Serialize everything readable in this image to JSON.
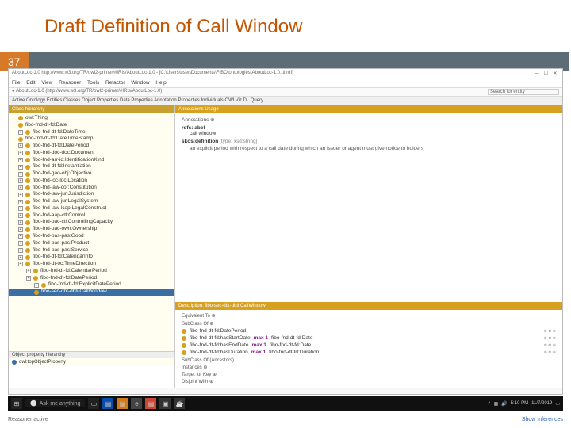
{
  "slide": {
    "title": "Draft Definition of Call Window",
    "number": "37"
  },
  "app_title": "AboutLoc-1.0  http://www.w3.org/TR/owl2-primer/#IRIs/AboutLoc-1.0  - [C:\\Users\\user\\Documents\\FIBO\\ontologies\\AboutLoc-1.0.ttl.rdf]",
  "window_controls": {
    "min": "—",
    "max": "☐",
    "close": "✕"
  },
  "menu": [
    "File",
    "Edit",
    "View",
    "Reasoner",
    "Tools",
    "Refactor",
    "Window",
    "Help"
  ],
  "address": "http://www.w3.org/TR/owl2-primer/#IRIs/AboutLoc-1.0",
  "search_placeholder": "Search for entity",
  "toolbar_text": "Active Ontology  Entities  Classes  Object Properties  Data Properties  Annotation Properties  Individuals  OWLViz  DL Query",
  "left_panel_title": "Class hierarchy",
  "tree": [
    {
      "label": "owl:Thing",
      "nest": 0
    },
    {
      "label": "fibo-fnd-dt-fd:Date",
      "nest": 0
    },
    {
      "label": "fibo-fnd-dt-fd:DateTime",
      "nest": 0,
      "exp": true
    },
    {
      "label": "fibo-fnd-dt-fd:DateTimeStamp",
      "nest": 0
    },
    {
      "label": "fibo-fnd-dt-fd:DatePeriod",
      "nest": 0,
      "exp": true
    },
    {
      "label": "fibo-fnd-doc-doc:Document",
      "nest": 0,
      "exp": true
    },
    {
      "label": "fibo-fnd-arr-id:IdentificationKind",
      "nest": 0,
      "exp": true
    },
    {
      "label": "fibo-fnd-dt-fd:Instantiation",
      "nest": 0,
      "exp": true
    },
    {
      "label": "fibo-fnd-gao-obj:Objective",
      "nest": 0,
      "exp": true
    },
    {
      "label": "fibo-fnd-loc-loc:Location",
      "nest": 0,
      "exp": true
    },
    {
      "label": "fibo-fnd-law-cor:Constitution",
      "nest": 0,
      "exp": true
    },
    {
      "label": "fibo-fnd-law-jur:Jurisdiction",
      "nest": 0,
      "exp": true
    },
    {
      "label": "fibo-fnd-law-jur:LegalSystem",
      "nest": 0,
      "exp": true
    },
    {
      "label": "fibo-fnd-law-lcap:LegalConstruct",
      "nest": 0,
      "exp": true
    },
    {
      "label": "fibo-fnd-aap-ctl:Control",
      "nest": 0,
      "exp": true
    },
    {
      "label": "fibo-fnd-oac-ctl:ControllingCapacity",
      "nest": 0,
      "exp": true
    },
    {
      "label": "fibo-fnd-oac-own:Ownership",
      "nest": 0,
      "exp": true
    },
    {
      "label": "fibo-fnd-pas-pas:Good",
      "nest": 0,
      "exp": true
    },
    {
      "label": "fibo-fnd-pas-pas:Product",
      "nest": 0,
      "exp": true
    },
    {
      "label": "fibo-fnd-pas-pas:Service",
      "nest": 0,
      "exp": true
    },
    {
      "label": "fibo-fnd-dt-fd:CalendarInfo",
      "nest": 0,
      "exp": true
    },
    {
      "label": "fibo-fnd-dt-oc:TimeDirection",
      "nest": 0,
      "exp": true
    },
    {
      "label": "fibo-fnd-dt-fd:CalendarPeriod",
      "nest": 1,
      "exp": true
    },
    {
      "label": "fibo-fnd-dt-fd:DatePeriod",
      "nest": 1,
      "exp": true
    },
    {
      "label": "fibo-fnd-dt-fd:ExplicitDatePeriod",
      "nest": 2,
      "exp": true
    },
    {
      "label": "fibo-sec-dbt-dbti:CallWindow",
      "nest": 2,
      "sel": true
    }
  ],
  "bottom_left": {
    "header": "Object property hierarchy",
    "item": "owl:topObjectProperty"
  },
  "right": {
    "annotations_hdr": "Annotations  Usage",
    "annotations": {
      "rdfs_label_key": "rdfs:label",
      "rdfs_label_val": "call window",
      "skos_def_key": "skos:definition",
      "skos_def_type": "[type: xsd:string]",
      "skos_def_val": "an explicit period with respect to a call date during which an issuer or agent must give notice to holders"
    },
    "desc_hdr": "Description: fibo-sec-dbt-dbti:CallWindow",
    "equiv_label": "Equivalent To",
    "subclass_label": "SubClass Of",
    "axioms": [
      {
        "lhs": "fibo-fnd-dt-fd:DatePeriod",
        "kw": "",
        "rhs": ""
      },
      {
        "lhs": "fibo-fnd-dt-fd:hasStartDate",
        "kw": "max 1",
        "rhs": "fibo-fnd-dt-fd:Date"
      },
      {
        "lhs": "fibo-fnd-dt-fd:hasEndDate",
        "kw": "max 1",
        "rhs": "fibo-fnd-dt-fd:Date"
      },
      {
        "lhs": "fibo-fnd-dt-fd:hasDuration",
        "kw": "max 1",
        "rhs": "fibo-fnd-dt-fd:Duration"
      }
    ],
    "subclass_anc_label": "SubClass Of (Ancestors)",
    "instances_label": "Instances",
    "target_label": "Target for Key",
    "disjoint_label": "Disjoint With"
  },
  "taskbar": {
    "search": "Ask me anything",
    "reasoner_status": "Reasoner active",
    "show_inferences": "Show Inferences",
    "time": "5:10 PM",
    "date": "11/7/2019"
  }
}
